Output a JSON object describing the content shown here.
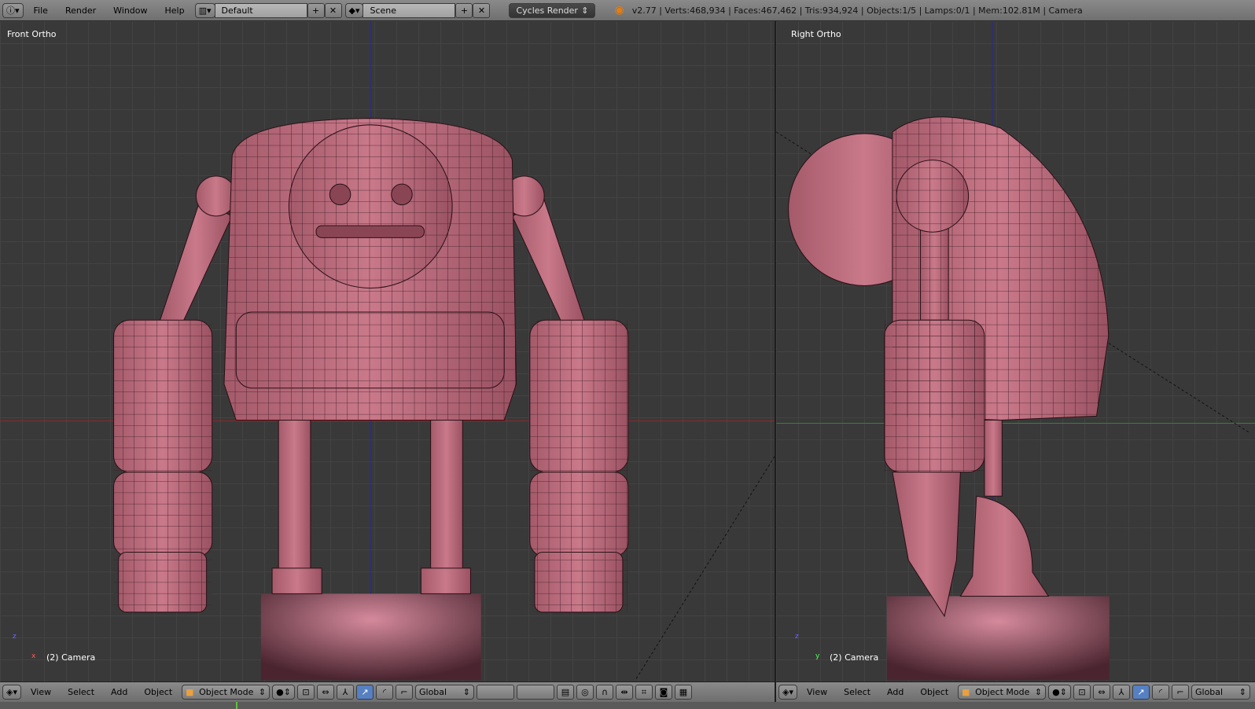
{
  "topbar": {
    "menus": [
      "File",
      "Render",
      "Window",
      "Help"
    ],
    "layout": "Default",
    "scene": "Scene",
    "engine": "Cycles Render",
    "stats": "v2.77 | Verts:468,934 | Faces:467,462 | Tris:934,924 | Objects:1/5 | Lamps:0/1 | Mem:102.81M | Camera"
  },
  "left_view": {
    "title": "Front Ortho",
    "object": "(2) Camera",
    "axes": [
      "z",
      "x"
    ]
  },
  "right_view": {
    "title": "Right Ortho",
    "object": "(2) Camera",
    "axes": [
      "z",
      "y"
    ]
  },
  "view_header": {
    "menus": [
      "View",
      "Select",
      "Add",
      "Object"
    ],
    "mode": "Object Mode",
    "orientation": "Global"
  },
  "colors": {
    "mesh": "#b86a7a",
    "background": "#393939",
    "x_axis": "#a02020",
    "y_axis": "#20a020",
    "z_axis": "#2020a0",
    "active_button": "#5680c2"
  }
}
